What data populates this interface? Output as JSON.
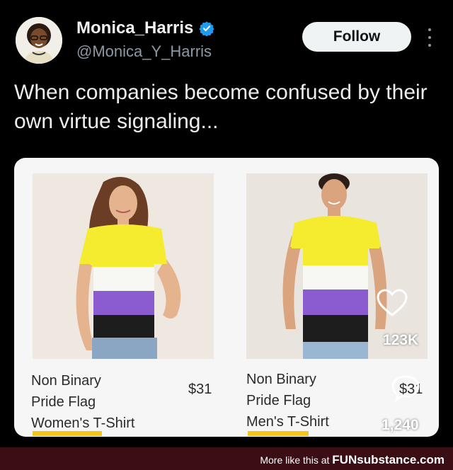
{
  "tweet": {
    "author_name": "Monica_Harris",
    "author_handle": "@Monica_Y_Harris",
    "follow_label": "Follow",
    "text": "When companies become confused by their own virtue signaling...",
    "verified_icon": "verified-badge-icon"
  },
  "media": {
    "products": [
      {
        "line1": "Non Binary",
        "line2": "Pride Flag",
        "line3": "Women's T-Shirt",
        "price": "$31"
      },
      {
        "line1": "Non Binary",
        "line2": "Pride Flag",
        "line3": "Men's T-Shirt",
        "price": "$31"
      }
    ],
    "likes": "123K",
    "comments": "1,240"
  },
  "colors": {
    "flag_yellow": "#f5ec2f",
    "flag_white": "#f5f5f5",
    "flag_purple": "#8a5cd0",
    "flag_black": "#1a1a1a"
  },
  "footer": {
    "text": "More like this at",
    "brand": "FUNsubstance.com"
  }
}
